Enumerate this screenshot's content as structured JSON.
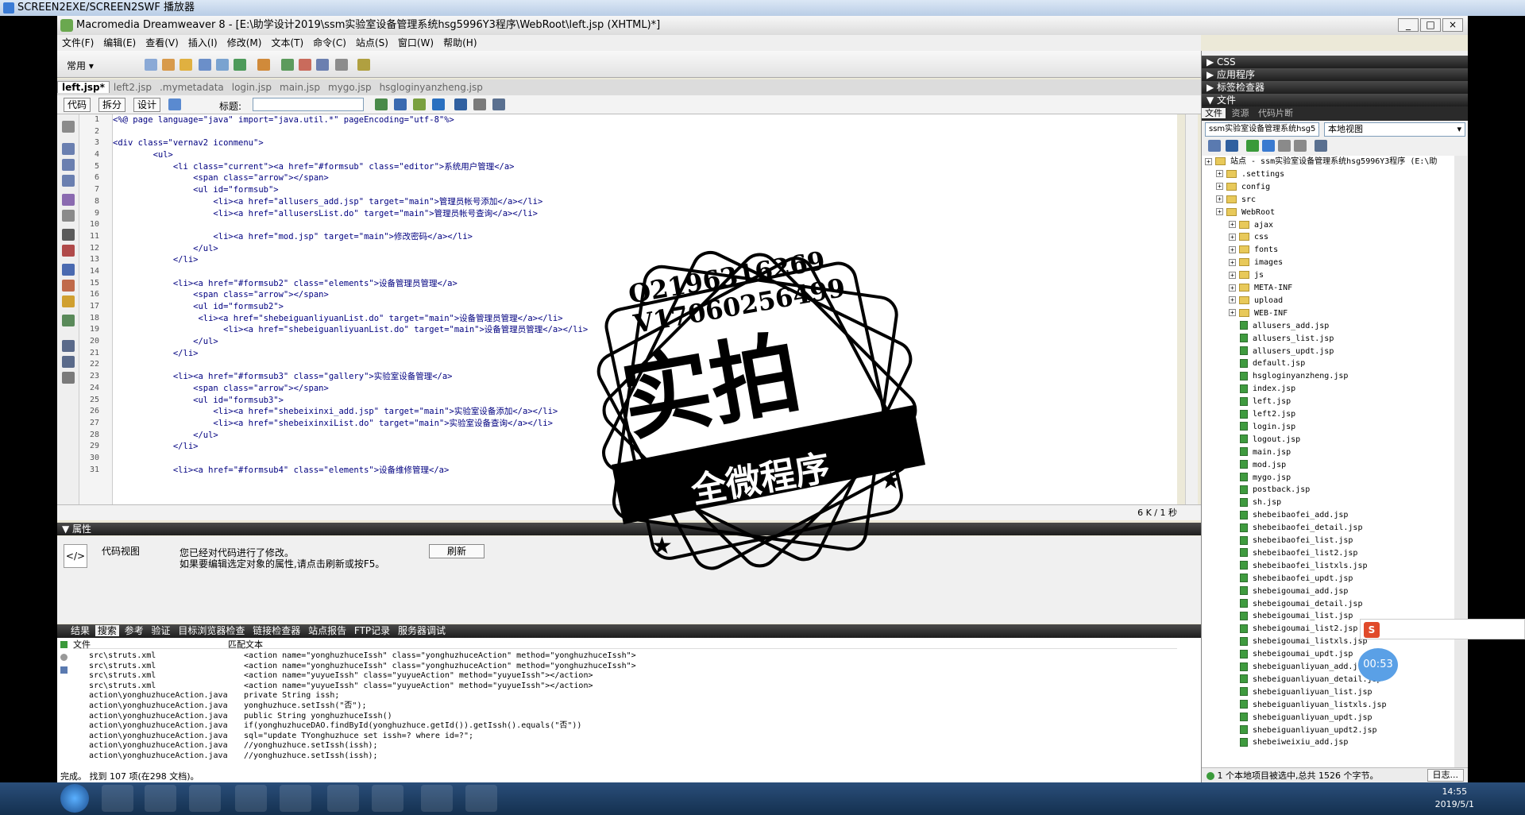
{
  "player": {
    "title": "SCREEN2EXE/SCREEN2SWF 播放器"
  },
  "window": {
    "title": "Macromedia Dreamweaver 8 - [E:\\助学设计2019\\ssm实验室设备管理系统hsg5996Y3程序\\WebRoot\\left.jsp (XHTML)*]"
  },
  "menu": [
    "文件(F)",
    "编辑(E)",
    "查看(V)",
    "插入(I)",
    "修改(M)",
    "文本(T)",
    "命令(C)",
    "站点(S)",
    "窗口(W)",
    "帮助(H)"
  ],
  "insert_bar": {
    "category": "常用"
  },
  "doc_tabs": [
    "left.jsp*",
    "left2.jsp",
    ".mymetadata",
    "login.jsp",
    "main.jsp",
    "mygo.jsp",
    "hsgloginyanzheng.jsp"
  ],
  "doc_toolbar": {
    "code": "代码",
    "split": "拆分",
    "design": "设计",
    "title_label": "标题:"
  },
  "code_lines": [
    "<%@ page language=\"java\" import=\"java.util.*\" pageEncoding=\"utf-8\"%>",
    "",
    "<div class=\"vernav2 iconmenu\">",
    "        <ul>",
    "            <li class=\"current\"><a href=\"#formsub\" class=\"editor\">系统用户管理</a>",
    "                <span class=\"arrow\"></span>",
    "                <ul id=\"formsub\">",
    "                    <li><a href=\"allusers_add.jsp\" target=\"main\">管理员帐号添加</a></li>",
    "                    <li><a href=\"allusersList.do\" target=\"main\">管理员帐号查询</a></li>",
    "",
    "                    <li><a href=\"mod.jsp\" target=\"main\">修改密码</a></li>",
    "                </ul>",
    "            </li>",
    "",
    "            <li><a href=\"#formsub2\" class=\"elements\">设备管理员管理</a>",
    "                <span class=\"arrow\"></span>",
    "                <ul id=\"formsub2\">",
    "                 <li><a href=\"shebeiguanliyuanList.do\" target=\"main\">设备管理员管理</a></li>",
    "                      <li><a href=\"shebeiguanliyuanList.do\" target=\"main\">设备管理员管理</a></li>",
    "                </ul>",
    "            </li>",
    "",
    "            <li><a href=\"#formsub3\" class=\"gallery\">实验室设备管理</a>",
    "                <span class=\"arrow\"></span>",
    "                <ul id=\"formsub3\">",
    "                    <li><a href=\"shebeixinxi_add.jsp\" target=\"main\">实验室设备添加</a></li>",
    "                    <li><a href=\"shebeixinxiList.do\" target=\"main\">实验室设备查询</a></li>",
    "                </ul>",
    "            </li>",
    "",
    "            <li><a href=\"#formsub4\" class=\"elements\">设备维修管理</a>"
  ],
  "code_status": "6 K / 1 秒",
  "properties": {
    "header": "属性",
    "view_label": "代码视图",
    "msg1": "您已经对代码进行了修改。",
    "msg2": "如果要编辑选定对象的属性,请点击刷新或按F5。",
    "refresh": "刷新"
  },
  "results_tabs": [
    "结果",
    "搜索",
    "参考",
    "验证",
    "目标浏览器检查",
    "链接检查器",
    "站点报告",
    "FTP记录",
    "服务器调试"
  ],
  "results_cols": {
    "file": "文件",
    "match": "匹配文本"
  },
  "results_rows": [
    {
      "file": "src\\struts.xml",
      "text": "<action name=\"yonghuzhuceIssh\" class=\"yonghuzhuceAction\" method=\"yonghuzhuceIssh\">"
    },
    {
      "file": "src\\struts.xml",
      "text": "<action name=\"yonghuzhuceIssh\" class=\"yonghuzhuceAction\" method=\"yonghuzhuceIssh\">"
    },
    {
      "file": "src\\struts.xml",
      "text": "<action name=\"yuyueIssh\" class=\"yuyueAction\" method=\"yuyueIssh\"></action>"
    },
    {
      "file": "src\\struts.xml",
      "text": "<action name=\"yuyueIssh\" class=\"yuyueAction\" method=\"yuyueIssh\"></action>"
    },
    {
      "file": "action\\yonghuzhuceAction.java",
      "text": "private String issh;"
    },
    {
      "file": "action\\yonghuzhuceAction.java",
      "text": "yonghuzhuce.setIssh(\"否\");"
    },
    {
      "file": "action\\yonghuzhuceAction.java",
      "text": "public String yonghuzhuceIssh()"
    },
    {
      "file": "action\\yonghuzhuceAction.java",
      "text": "if(yonghuzhuceDAO.findById(yonghuzhuce.getId()).getIssh().equals(\"否\"))"
    },
    {
      "file": "action\\yonghuzhuceAction.java",
      "text": "sql=\"update TYonghuzhuce set issh=? where id=?\";"
    },
    {
      "file": "action\\yonghuzhuceAction.java",
      "text": "//yonghuzhuce.setIssh(issh);"
    },
    {
      "file": "action\\yonghuzhuceAction.java",
      "text": "//yonghuzhuce.setIssh(issh);"
    }
  ],
  "results_status": "完成。 找到 107 项(在298 文档)。",
  "right_panel": {
    "css": "CSS",
    "app": "应用程序",
    "tag": "标签检查器",
    "files": "文件",
    "tabs": [
      "文件",
      "资源",
      "代码片断"
    ],
    "site_select": "ssm实验室设备管理系统hsg5",
    "view_select": "本地视图",
    "site_root": "站点 - ssm实验室设备管理系统hsg5996Y3程序 (E:\\助"
  },
  "tree_folders": [
    ".settings",
    "config",
    "src",
    "WebRoot"
  ],
  "webroot_folders": [
    "ajax",
    "css",
    "fonts",
    "images",
    "js",
    "META-INF",
    "upload",
    "WEB-INF"
  ],
  "tree_files": [
    "allusers_add.jsp",
    "allusers_list.jsp",
    "allusers_updt.jsp",
    "default.jsp",
    "hsgloginyanzheng.jsp",
    "index.jsp",
    "left.jsp",
    "left2.jsp",
    "login.jsp",
    "logout.jsp",
    "main.jsp",
    "mod.jsp",
    "mygo.jsp",
    "postback.jsp",
    "sh.jsp",
    "shebeibaofei_add.jsp",
    "shebeibaofei_detail.jsp",
    "shebeibaofei_list.jsp",
    "shebeibaofei_list2.jsp",
    "shebeibaofei_listxls.jsp",
    "shebeibaofei_updt.jsp",
    "shebeigoumai_add.jsp",
    "shebeigoumai_detail.jsp",
    "shebeigoumai_list.jsp",
    "shebeigoumai_list2.jsp",
    "shebeigoumai_listxls.jsp",
    "shebeigoumai_updt.jsp",
    "shebeiguanliyuan_add.jsp",
    "shebeiguanliyuan_detail.jsp",
    "shebeiguanliyuan_list.jsp",
    "shebeiguanliyuan_listxls.jsp",
    "shebeiguanliyuan_updt.jsp",
    "shebeiguanliyuan_updt2.jsp",
    "shebeiweixiu_add.jsp"
  ],
  "site_status": "1 个本地项目被选中,总共 1526 个字节。",
  "log_button": "日志...",
  "watermark": {
    "line1": "Q2196316269",
    "line2": "V17060256499",
    "big": "实拍",
    "banner": "全微程序"
  },
  "timer": "00:53",
  "clock": {
    "time": "14:55",
    "date": "2019/5/1"
  },
  "colors": {
    "accent": "#3169c6",
    "taskbar": "#1f3f66"
  }
}
